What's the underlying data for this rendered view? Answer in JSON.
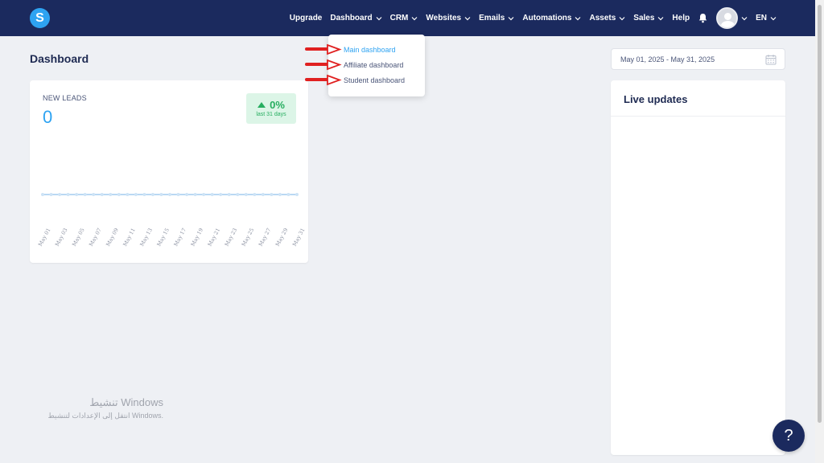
{
  "app": {
    "logo_letter": "S"
  },
  "nav": {
    "items": [
      {
        "label": "Upgrade",
        "has_chevron": false
      },
      {
        "label": "Dashboard",
        "has_chevron": true
      },
      {
        "label": "CRM",
        "has_chevron": true
      },
      {
        "label": "Websites",
        "has_chevron": true
      },
      {
        "label": "Emails",
        "has_chevron": true
      },
      {
        "label": "Automations",
        "has_chevron": true
      },
      {
        "label": "Assets",
        "has_chevron": true
      },
      {
        "label": "Sales",
        "has_chevron": true
      },
      {
        "label": "Help",
        "has_chevron": false
      }
    ],
    "language": "EN"
  },
  "dropdown": {
    "items": [
      {
        "label": "Main dashboard",
        "active": true
      },
      {
        "label": "Affiliate dashboard",
        "active": false
      },
      {
        "label": "Student dashboard",
        "active": false
      }
    ]
  },
  "page": {
    "title": "Dashboard"
  },
  "leads": {
    "label": "NEW LEADS",
    "value": "0",
    "badge_value": "0%",
    "badge_sub": "last 31 days"
  },
  "chart_data": {
    "type": "line",
    "x": [
      "May 01",
      "May 02",
      "May 03",
      "May 04",
      "May 05",
      "May 06",
      "May 07",
      "May 08",
      "May 09",
      "May 10",
      "May 11",
      "May 12",
      "May 13",
      "May 14",
      "May 15",
      "May 16",
      "May 17",
      "May 18",
      "May 19",
      "May 20",
      "May 21",
      "May 22",
      "May 23",
      "May 24",
      "May 25",
      "May 26",
      "May 27",
      "May 28",
      "May 29",
      "May 30",
      "May 31"
    ],
    "tick_labels": [
      "May 01",
      "May 03",
      "May 05",
      "May 07",
      "May 09",
      "May 11",
      "May 13",
      "May 15",
      "May 17",
      "May 19",
      "May 21",
      "May 23",
      "May 25",
      "May 27",
      "May 29",
      "May 31"
    ],
    "series": [
      {
        "values": [
          0,
          0,
          0,
          0,
          0,
          0,
          0,
          0,
          0,
          0,
          0,
          0,
          0,
          0,
          0,
          0,
          0,
          0,
          0,
          0,
          0,
          0,
          0,
          0,
          0,
          0,
          0,
          0,
          0,
          0,
          0
        ]
      }
    ],
    "title": "",
    "xlabel": "",
    "ylabel": "",
    "grid": false,
    "colors": {
      "line": "#b9d8f3",
      "points": "#cde3f6"
    }
  },
  "date_range": {
    "value": "May 01, 2025 - May 31, 2025"
  },
  "live": {
    "title": "Live updates"
  },
  "watermark": {
    "line1": "تنشيط Windows",
    "line2": "انتقل إلى الإعدادات لتنشيط Windows."
  },
  "help": {
    "label": "?"
  },
  "colors": {
    "nav_bg": "#1b2a5e",
    "accent": "#2ea3f2",
    "success": "#27ae60",
    "annotation_arrow": "#e02020"
  }
}
